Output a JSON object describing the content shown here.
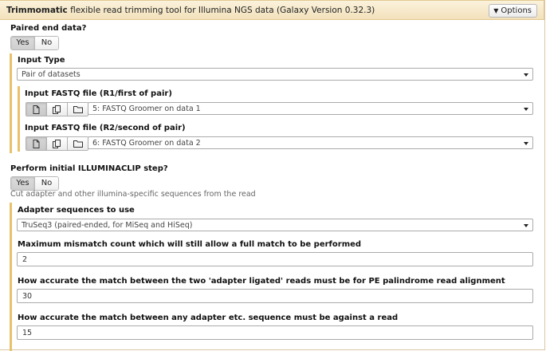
{
  "header": {
    "tool_name": "Trimmomatic",
    "tool_desc": "flexible read trimming tool for Illumina NGS data (Galaxy Version 0.32.3)",
    "options_label": "Options"
  },
  "paired": {
    "label": "Paired end data?",
    "yes": "Yes",
    "no": "No",
    "selected": "Yes"
  },
  "input_type": {
    "label": "Input Type",
    "value": "Pair of datasets"
  },
  "fastq_r1": {
    "label": "Input FASTQ file (R1/first of pair)",
    "value": "5: FASTQ Groomer on data 1"
  },
  "fastq_r2": {
    "label": "Input FASTQ file (R2/second of pair)",
    "value": "6: FASTQ Groomer on data 2"
  },
  "illuminaclip": {
    "label": "Perform initial ILLUMINACLIP step?",
    "yes": "Yes",
    "no": "No",
    "selected": "Yes",
    "help": "Cut adapter and other illumina-specific sequences from the read"
  },
  "adapter": {
    "label": "Adapter sequences to use",
    "value": "TruSeq3 (paired-ended, for MiSeq and HiSeq)"
  },
  "mismatch": {
    "label": "Maximum mismatch count which will still allow a full match to be performed",
    "value": "2"
  },
  "palindrome": {
    "label": "How accurate the match between the two 'adapter ligated' reads must be for PE palindrome read alignment",
    "value": "30"
  },
  "simple_clip": {
    "label": "How accurate the match between any adapter etc. sequence must be against a read",
    "value": "15"
  },
  "source_icons": [
    "file-icon",
    "copy-icon",
    "folder-icon"
  ],
  "colors": {
    "header_bg": "#f2e1bb",
    "section_bar": "#e8c26a"
  }
}
